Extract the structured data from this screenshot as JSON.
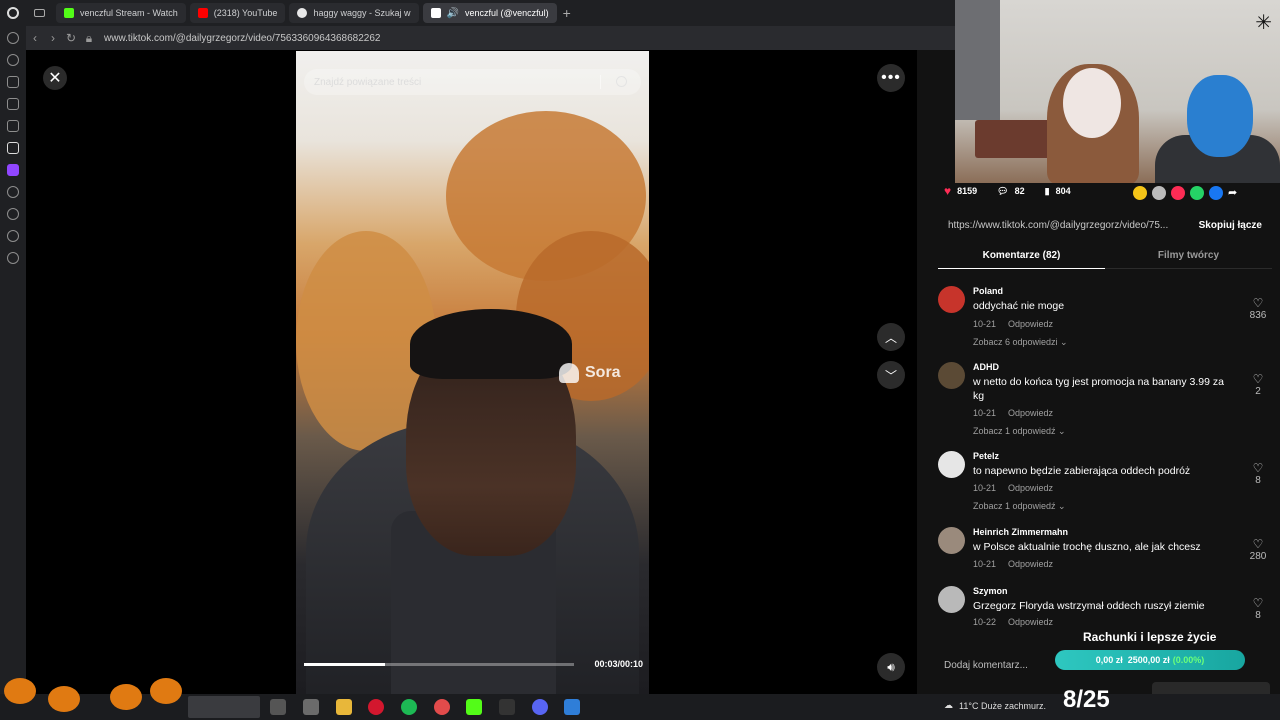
{
  "browser": {
    "tabs": [
      {
        "label": "venczful Stream - Watch",
        "color": "#53fc18"
      },
      {
        "label": "(2318) YouTube",
        "color": "#ff0000"
      },
      {
        "label": "haggy waggy - Szukaj w",
        "color": "#e8e8e8"
      },
      {
        "label": "venczful (@venczful)",
        "color": "#ffffff"
      }
    ],
    "url": "www.tiktok.com/@dailygrzegorz/video/7563360964368682262"
  },
  "video": {
    "search_placeholder": "Znajdź powiązane treści",
    "watermark": "Sora",
    "time": "00:03/00:10",
    "progress": 0.3
  },
  "stats": {
    "likes": "8159",
    "comments": "82",
    "saves": "804"
  },
  "link": {
    "url": "https://www.tiktok.com/@dailygrzegorz/video/75...",
    "copy_label": "Skopiuj łącze"
  },
  "tabs": {
    "comments": "Komentarze (82)",
    "creator": "Filmy twórcy"
  },
  "comments": [
    {
      "user": "Poland",
      "text": "oddychać nie moge",
      "date": "10-21",
      "reply": "Odpowiedz",
      "replies": "Zobacz 6 odpowiedzi ⌄",
      "likes": "836",
      "avatar": "#c7342b"
    },
    {
      "user": "ADHD",
      "text": "w netto do końca tyg jest promocja na banany 3.99 za kg",
      "date": "10-21",
      "reply": "Odpowiedz",
      "replies": "Zobacz 1 odpowiedź ⌄",
      "likes": "2",
      "avatar": "#5b4a35"
    },
    {
      "user": "Petelz",
      "text": "to napewno będzie zabierająca oddech podróż",
      "date": "10-21",
      "reply": "Odpowiedz",
      "replies": "Zobacz 1 odpowiedź ⌄",
      "likes": "8",
      "avatar": "#e6e6e6"
    },
    {
      "user": "Heinrich Zimmermahn",
      "text": "w Polsce aktualnie trochę duszno, ale jak chcesz",
      "date": "10-21",
      "reply": "Odpowiedz",
      "replies": "",
      "likes": "280",
      "avatar": "#9a8a7c"
    },
    {
      "user": "Szymon",
      "text": "Grzegorz Floryda wstrzymał oddech ruszył ziemie",
      "date": "10-22",
      "reply": "Odpowiedz",
      "replies": "",
      "likes": "8",
      "avatar": "#b9b9b9"
    }
  ],
  "add_comment": "Dodaj komentarz...",
  "goal": {
    "title": "Rachunki i lepsze życie",
    "current": "0,00 zł",
    "target": "2500,00 zł",
    "percent": "(0.00%)"
  },
  "taskbar": {
    "weather": "11°C Duże zachmurz.",
    "counter": "8/25"
  }
}
